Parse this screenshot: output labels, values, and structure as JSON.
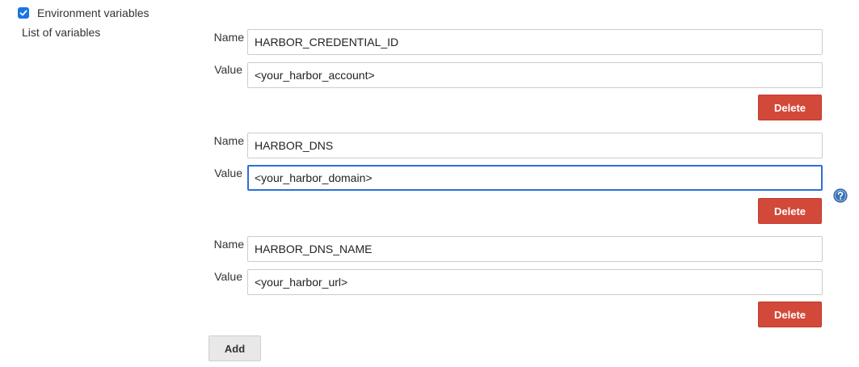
{
  "env_checkbox": {
    "label": "Environment variables",
    "checked": true
  },
  "list_label": "List of variables",
  "variables": [
    {
      "name_label": "Name",
      "name_value": "HARBOR_CREDENTIAL_ID",
      "value_label": "Value",
      "value_value": "<your_harbor_account>",
      "delete_label": "Delete"
    },
    {
      "name_label": "Name",
      "name_value": "HARBOR_DNS",
      "value_label": "Value",
      "value_value": "<your_harbor_domain>",
      "delete_label": "Delete"
    },
    {
      "name_label": "Name",
      "name_value": "HARBOR_DNS_NAME",
      "value_label": "Value",
      "value_value": "<your_harbor_url>",
      "delete_label": "Delete"
    }
  ],
  "add_label": "Add",
  "icons": {
    "checkbox": "checkmark-icon",
    "help": "help-icon"
  },
  "colors": {
    "delete_button": "#d24939",
    "focus_border": "#2f6fd6",
    "checkbox": "#1a73e8",
    "help_icon": "#3b73b9"
  }
}
